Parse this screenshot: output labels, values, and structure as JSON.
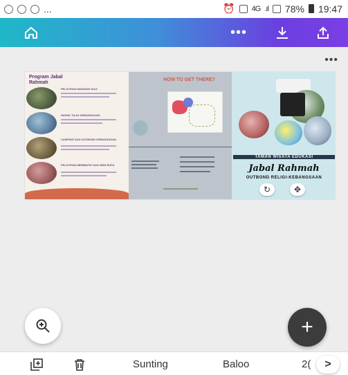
{
  "statusbar": {
    "left_more": "...",
    "network": "4G",
    "battery": "78%",
    "time": "19:47"
  },
  "toolbar": {
    "more": "•••"
  },
  "canvas": {
    "page_menu": "•••"
  },
  "design": {
    "left_title": "Program Jabal Rahmah",
    "map_title": "HOW TO GET THERE?",
    "cover_subtitle": "TAMAN WISATA EDUKASI",
    "cover_title": "Jabal Rahmah",
    "cover_tagline": "OUTBOND RELIGI-KEBANGSAAN",
    "left_items": [
      "PELATIHAN MANASIK HAJI",
      "NAPAK TILAS KEBANGSAAN",
      "CAMPING DAN OUTBOND KEBANGSAAN",
      "PELATIHAN MEMBATIK DAN SENI RUPA"
    ]
  },
  "bottombar": {
    "edit": "Sunting",
    "font": "Baloo",
    "size": "2(",
    "next": ">"
  },
  "colors": {
    "toolbar_start": "#1fb8c9",
    "toolbar_end": "#7b3fe4",
    "fab": "#3c3c3c"
  }
}
